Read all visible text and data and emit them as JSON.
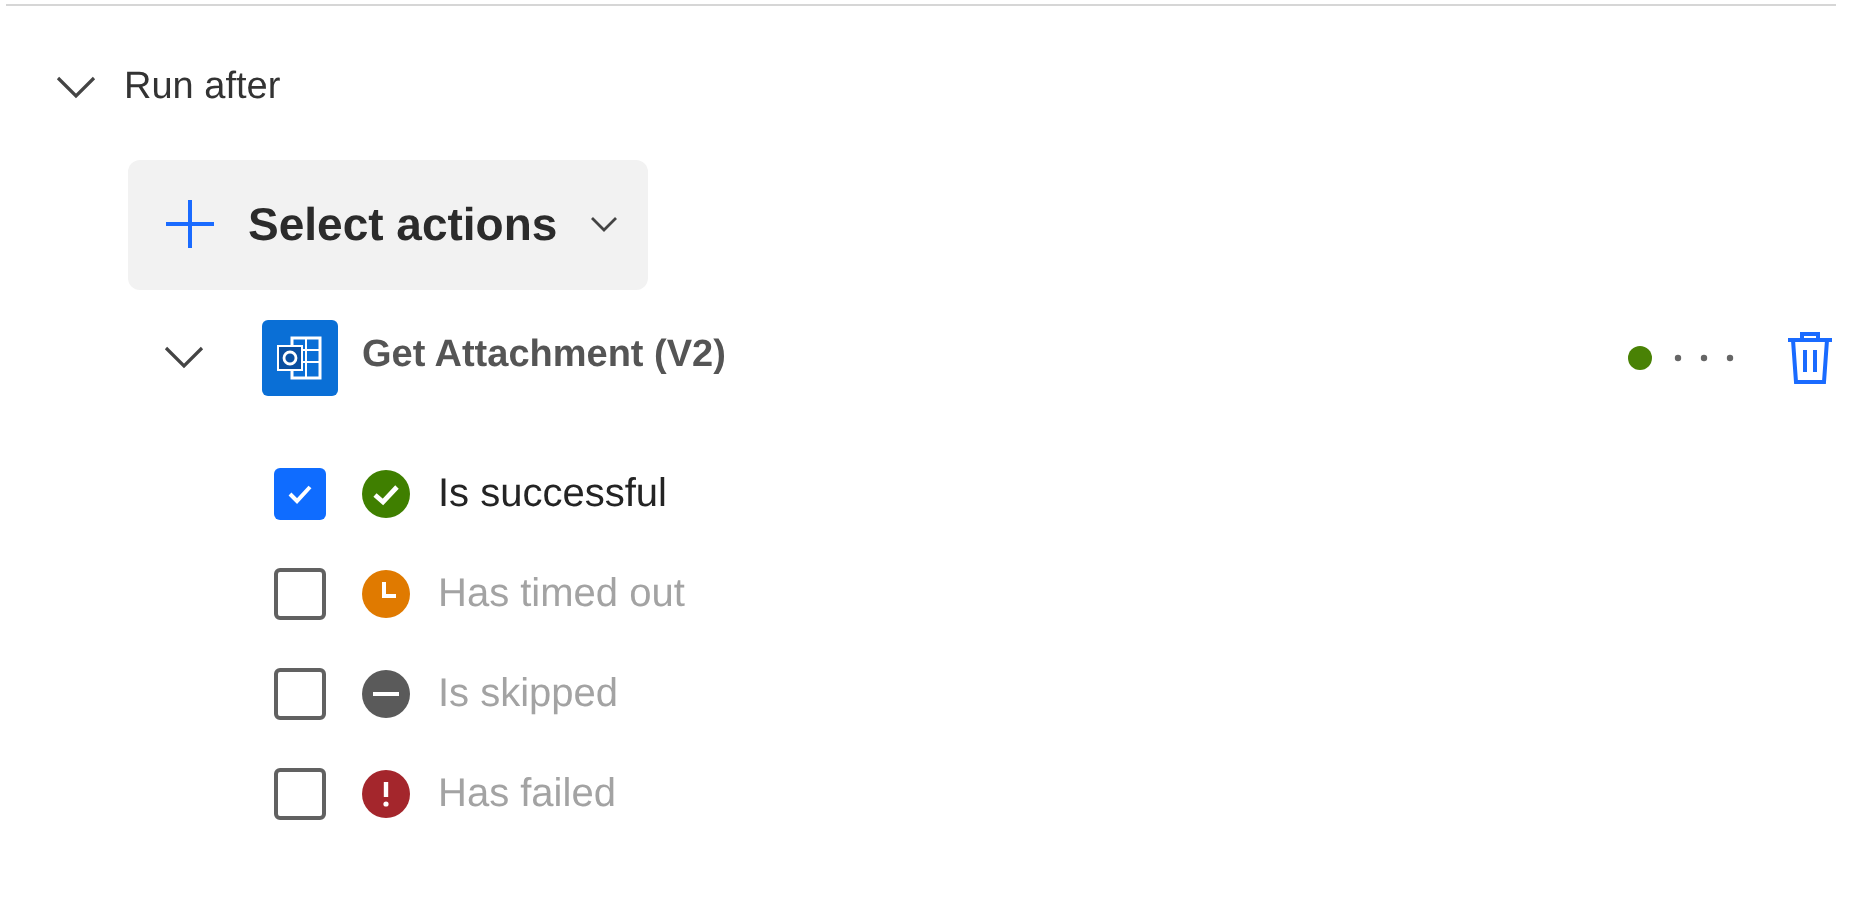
{
  "section": {
    "title": "Run after",
    "expanded": true
  },
  "select_button": {
    "label": "Select actions"
  },
  "action": {
    "name": "Get Attachment (V2)",
    "expanded": true,
    "conditions": [
      {
        "kind": "success",
        "label": "Is successful",
        "checked": true
      },
      {
        "kind": "timeout",
        "label": "Has timed out",
        "checked": false
      },
      {
        "kind": "skipped",
        "label": "Is skipped",
        "checked": false
      },
      {
        "kind": "failed",
        "label": "Has failed",
        "checked": false
      }
    ]
  }
}
